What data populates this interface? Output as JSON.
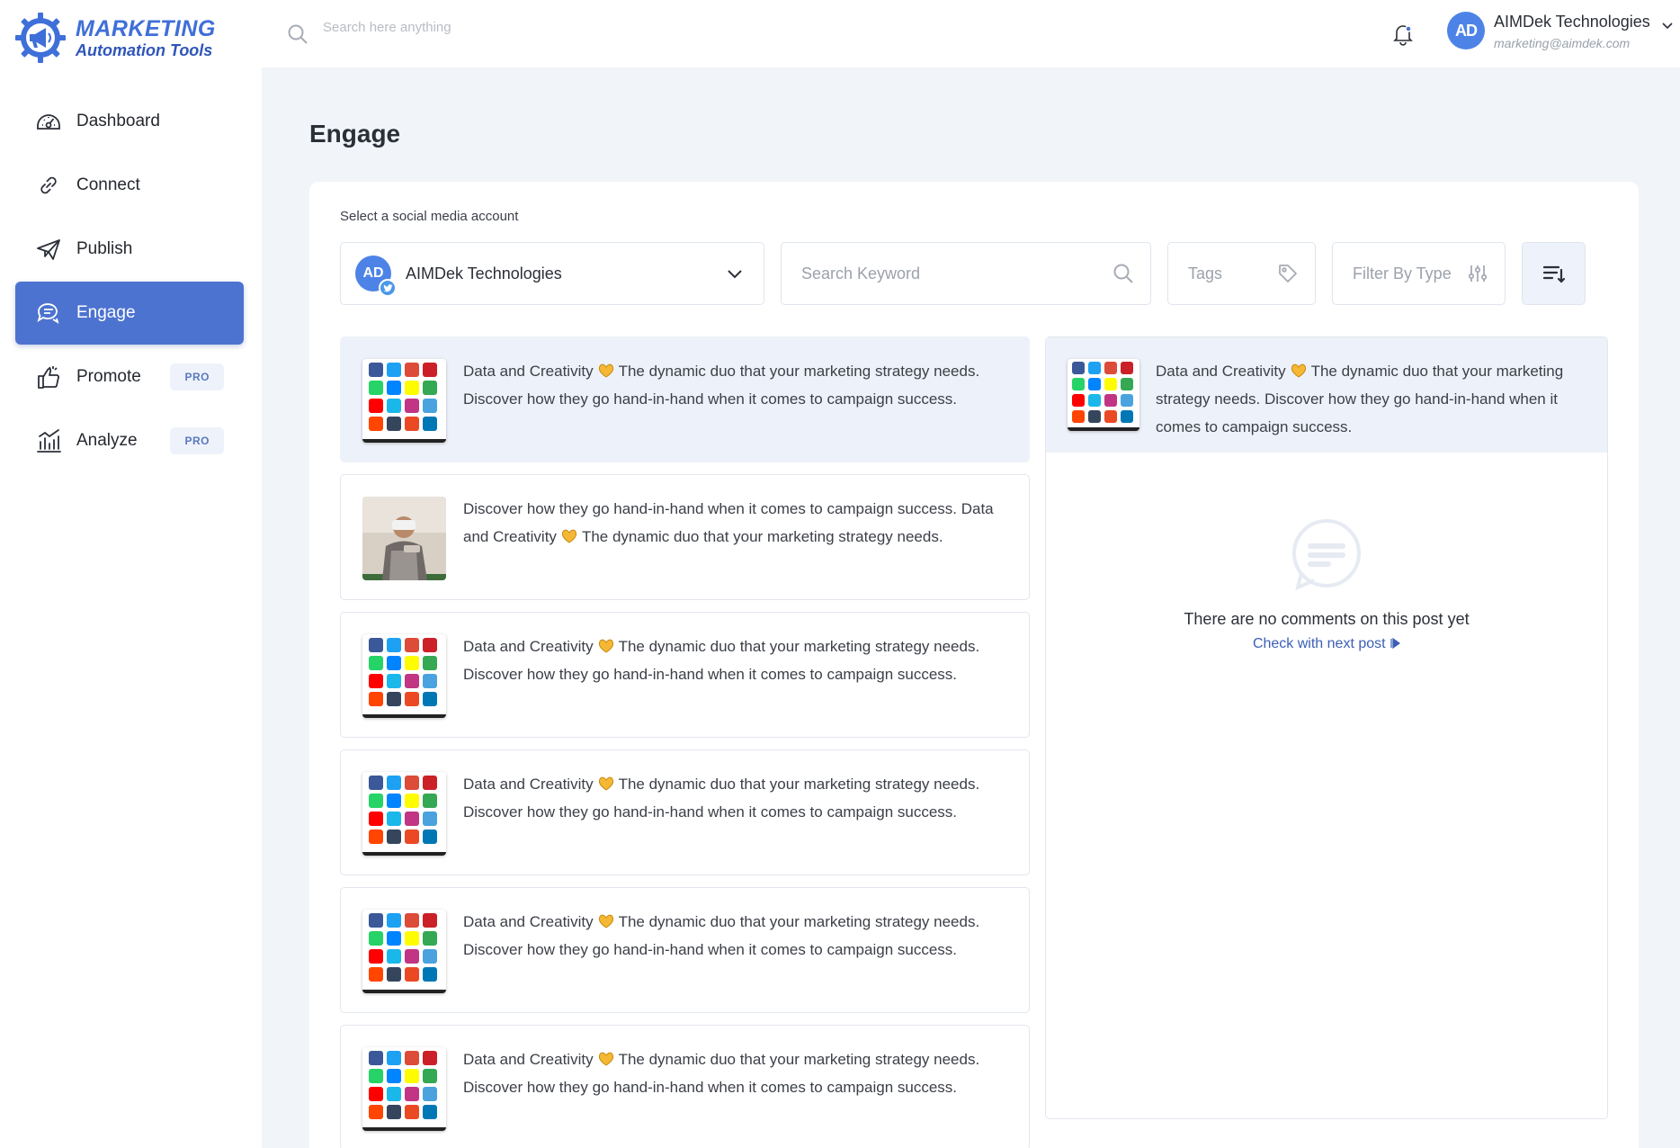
{
  "brand": {
    "line1": "MARKETING",
    "line2": "Automation Tools"
  },
  "topbar": {
    "search_placeholder": "Search here anything",
    "user_initials": "AD",
    "user_name": "AIMDek Technologies",
    "user_email": "marketing@aimdek.com"
  },
  "nav": {
    "items": [
      {
        "label": "Dashboard",
        "icon": "dashboard-icon"
      },
      {
        "label": "Connect",
        "icon": "link-icon"
      },
      {
        "label": "Publish",
        "icon": "paper-plane-icon"
      },
      {
        "label": "Engage",
        "icon": "chat-icon",
        "active": true
      },
      {
        "label": "Promote",
        "icon": "thumbs-up-icon",
        "badge": "PRO"
      },
      {
        "label": "Analyze",
        "icon": "bar-chart-icon",
        "badge": "PRO"
      }
    ]
  },
  "page": {
    "title": "Engage",
    "select_label": "Select a social media account",
    "account_name": "AIMDek Technologies",
    "account_initials": "AD",
    "keyword_placeholder": "Search Keyword",
    "tags_placeholder": "Tags",
    "filter_placeholder": "Filter By Type"
  },
  "posts": [
    {
      "before": "Data and Creativity",
      "after": "The dynamic duo that your marketing strategy needs. Discover how they go hand-in-hand when it comes to campaign success.",
      "thumb": "social-grid"
    },
    {
      "before": "Discover how they go hand-in-hand when it comes to campaign success. Data and Creativity",
      "after": "The dynamic duo that your marketing strategy needs.",
      "thumb": "photo"
    },
    {
      "before": "Data and Creativity",
      "after": "The dynamic duo that your marketing strategy needs. Discover how they go hand-in-hand when it comes to campaign success.",
      "thumb": "social-grid"
    },
    {
      "before": "Data and Creativity",
      "after": "The dynamic duo that your marketing strategy needs. Discover how they go hand-in-hand when it comes to campaign success.",
      "thumb": "social-grid"
    },
    {
      "before": "Data and Creativity",
      "after": "The dynamic duo that your marketing strategy needs. Discover how they go hand-in-hand when it comes to campaign success.",
      "thumb": "social-grid"
    },
    {
      "before": "Data and Creativity",
      "after": "The dynamic duo that your marketing strategy needs. Discover how they go hand-in-hand when it comes to campaign success.",
      "thumb": "social-grid"
    }
  ],
  "detail": {
    "before": "Data and Creativity",
    "after": "The dynamic duo that your marketing strategy needs. Discover how they go hand-in-hand when it comes to campaign success.",
    "empty_text": "There are no comments on this post yet",
    "empty_link": "Check with next post"
  },
  "colors": {
    "accent": "#4d73d0",
    "social_grid": [
      "#3b5998",
      "#1da1f2",
      "#dd4b39",
      "#cb2027",
      "#25d366",
      "#0084ff",
      "#fffc00",
      "#34a853",
      "#ff0000",
      "#1ab7ea",
      "#c13584",
      "#4aa3df",
      "#ff4500",
      "#35465c",
      "#eb4924",
      "#0077b5"
    ]
  }
}
